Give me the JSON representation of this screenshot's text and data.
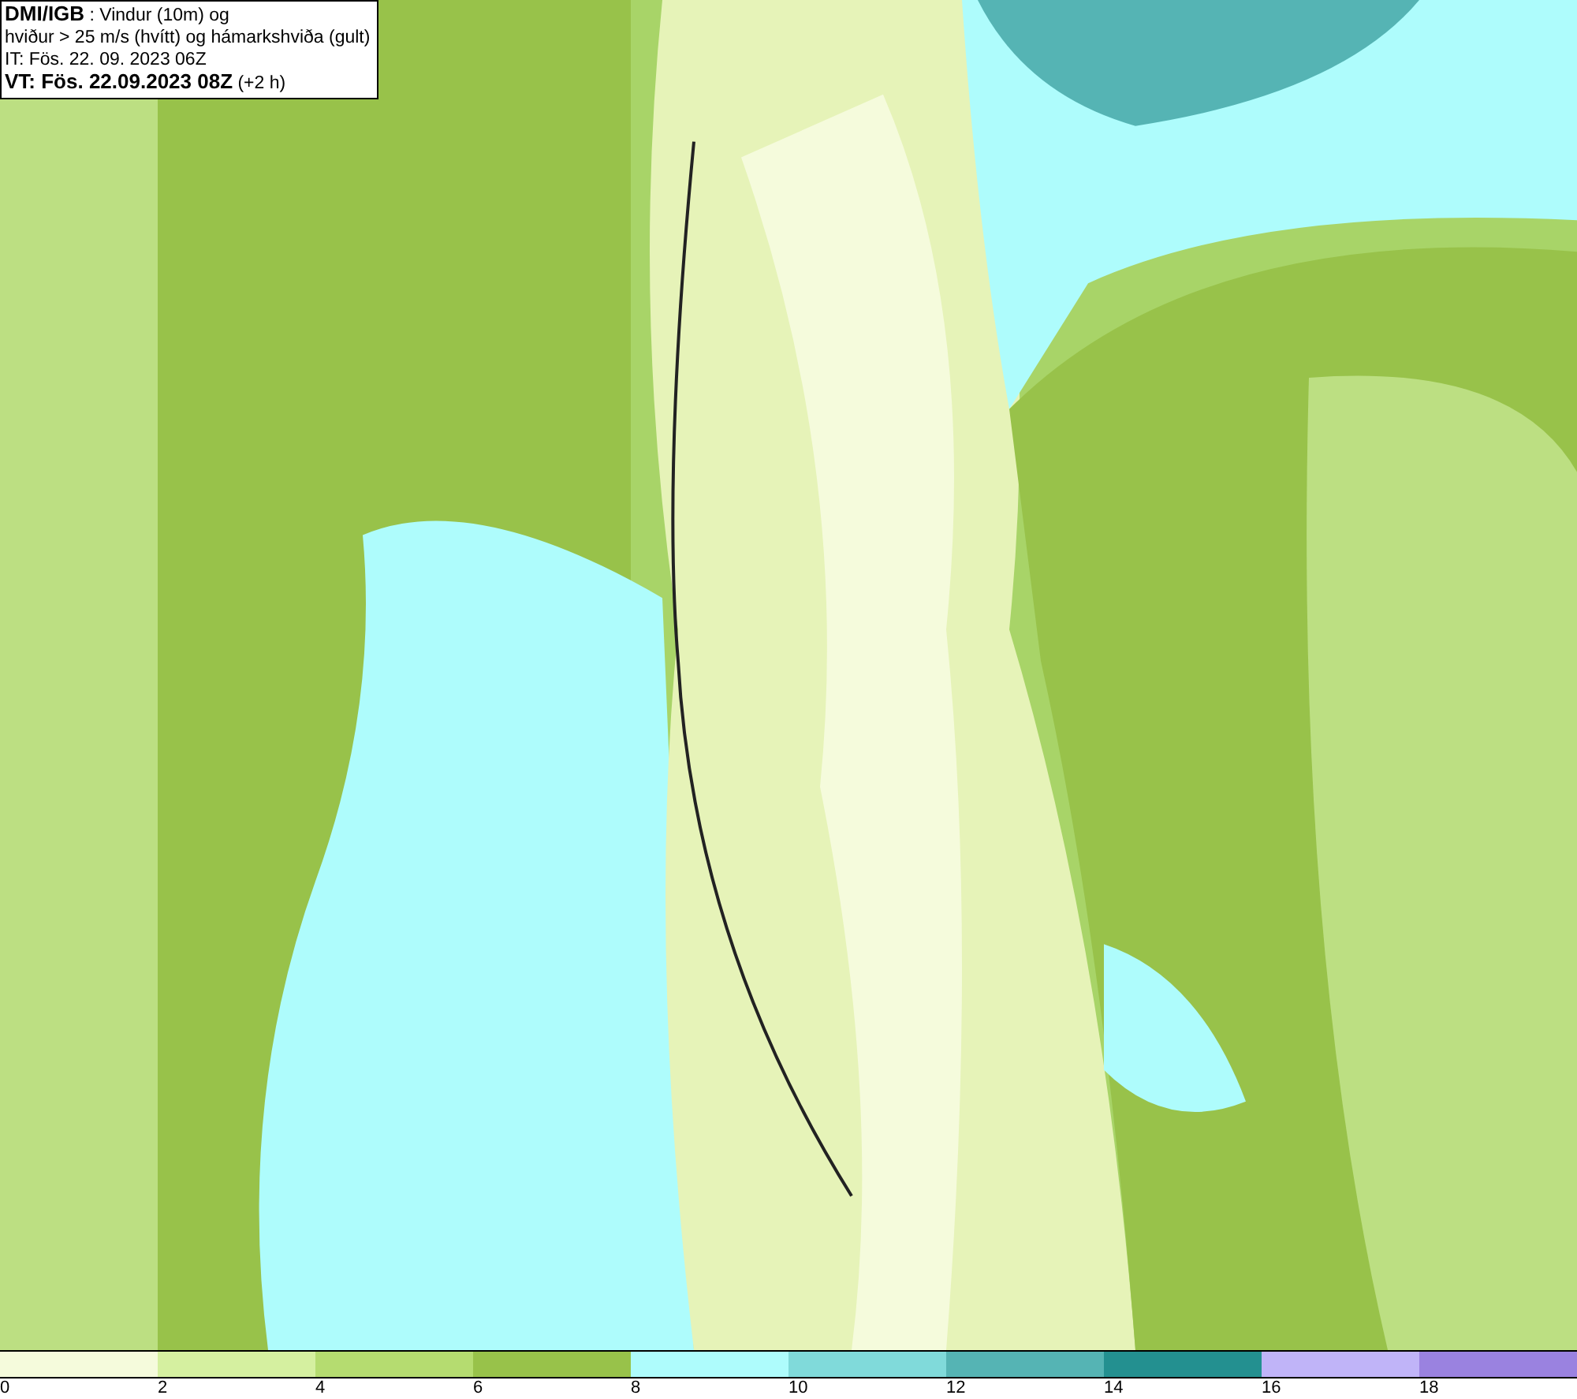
{
  "title_box": {
    "lines": [
      "**DMI/IGB** : Vindur (10m) og",
      "hviður > 25 m/s (hvítt) og hámarkshviða (gult)",
      "IT: Fös. 22. 09. 2023 06Z",
      "**VT: Fös. 22.09.2023 08Z** (+2 h)"
    ]
  },
  "legend": [
    {
      "color": "#f5fbdc",
      "label": "0"
    },
    {
      "color": "#d5f0a0",
      "label": "2"
    },
    {
      "color": "#b5dc70",
      "label": "4"
    },
    {
      "color": "#98c24a",
      "label": "6"
    },
    {
      "color": "#aefcfc",
      "label": "8"
    },
    {
      "color": "#80dada",
      "label": "10"
    },
    {
      "color": "#55b4b4",
      "label": "12"
    },
    {
      "color": "#239090",
      "label": "14"
    },
    {
      "color": "#c0b4f8",
      "label": "16"
    },
    {
      "color": "#9a82e0",
      "label": "18"
    }
  ]
}
